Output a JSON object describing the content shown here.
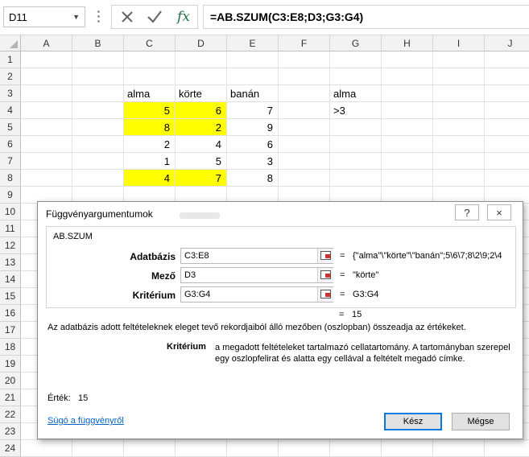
{
  "formula_bar": {
    "name_box": "D11",
    "formula": "=AB.SZUM(C3:E8;D3;G3:G4)",
    "fx_label": "fx"
  },
  "sheet": {
    "columns": [
      "A",
      "B",
      "C",
      "D",
      "E",
      "F",
      "G",
      "H",
      "I",
      "J"
    ],
    "rows": [
      "1",
      "2",
      "3",
      "4",
      "5",
      "6",
      "7",
      "8",
      "9",
      "10",
      "11",
      "12",
      "13",
      "14",
      "15",
      "16",
      "17",
      "18",
      "19",
      "20",
      "21",
      "22",
      "23",
      "24"
    ],
    "cells": {
      "C3": "alma",
      "D3": "körte",
      "E3": "banán",
      "G3": "alma",
      "C4": "5",
      "D4": "6",
      "E4": "7",
      "G4": ">3",
      "C5": "8",
      "D5": "2",
      "E5": "9",
      "C6": "2",
      "D6": "4",
      "E6": "6",
      "C7": "1",
      "D7": "5",
      "E7": "3",
      "C8": "4",
      "D8": "7",
      "E8": "8"
    },
    "highlight_color": "#ffff00"
  },
  "dialog": {
    "title": "Függvényargumentumok",
    "help_button": "?",
    "close_button": "×",
    "function_name": "AB.SZUM",
    "args": [
      {
        "label": "Adatbázis",
        "value": "C3:E8",
        "eq": "=",
        "result": "{\"alma\"\\\"körte\"\\\"banán\";5\\6\\7;8\\2\\9;2\\4"
      },
      {
        "label": "Mező",
        "value": "D3",
        "eq": "=",
        "result": "\"körte\""
      },
      {
        "label": "Kritérium",
        "value": "G3:G4",
        "eq": "=",
        "result": "G3:G4"
      }
    ],
    "result_eq": "=",
    "result_value": "15",
    "description": "Az adatbázis adott feltételeknek eleget tevő rekordjaiból álló mezőben (oszlopban) összeadja az értékeket.",
    "criterion_label": "Kritérium",
    "criterion_desc": "a megadott feltételeket tartalmazó cellatartomány. A tartományban szerepel egy oszlopfelirat és alatta egy cellával a feltételt megadó címke.",
    "value_label": "Érték:",
    "value": "15",
    "help_link": "Súgó a függvényről",
    "ok": "Kész",
    "cancel": "Mégse"
  }
}
